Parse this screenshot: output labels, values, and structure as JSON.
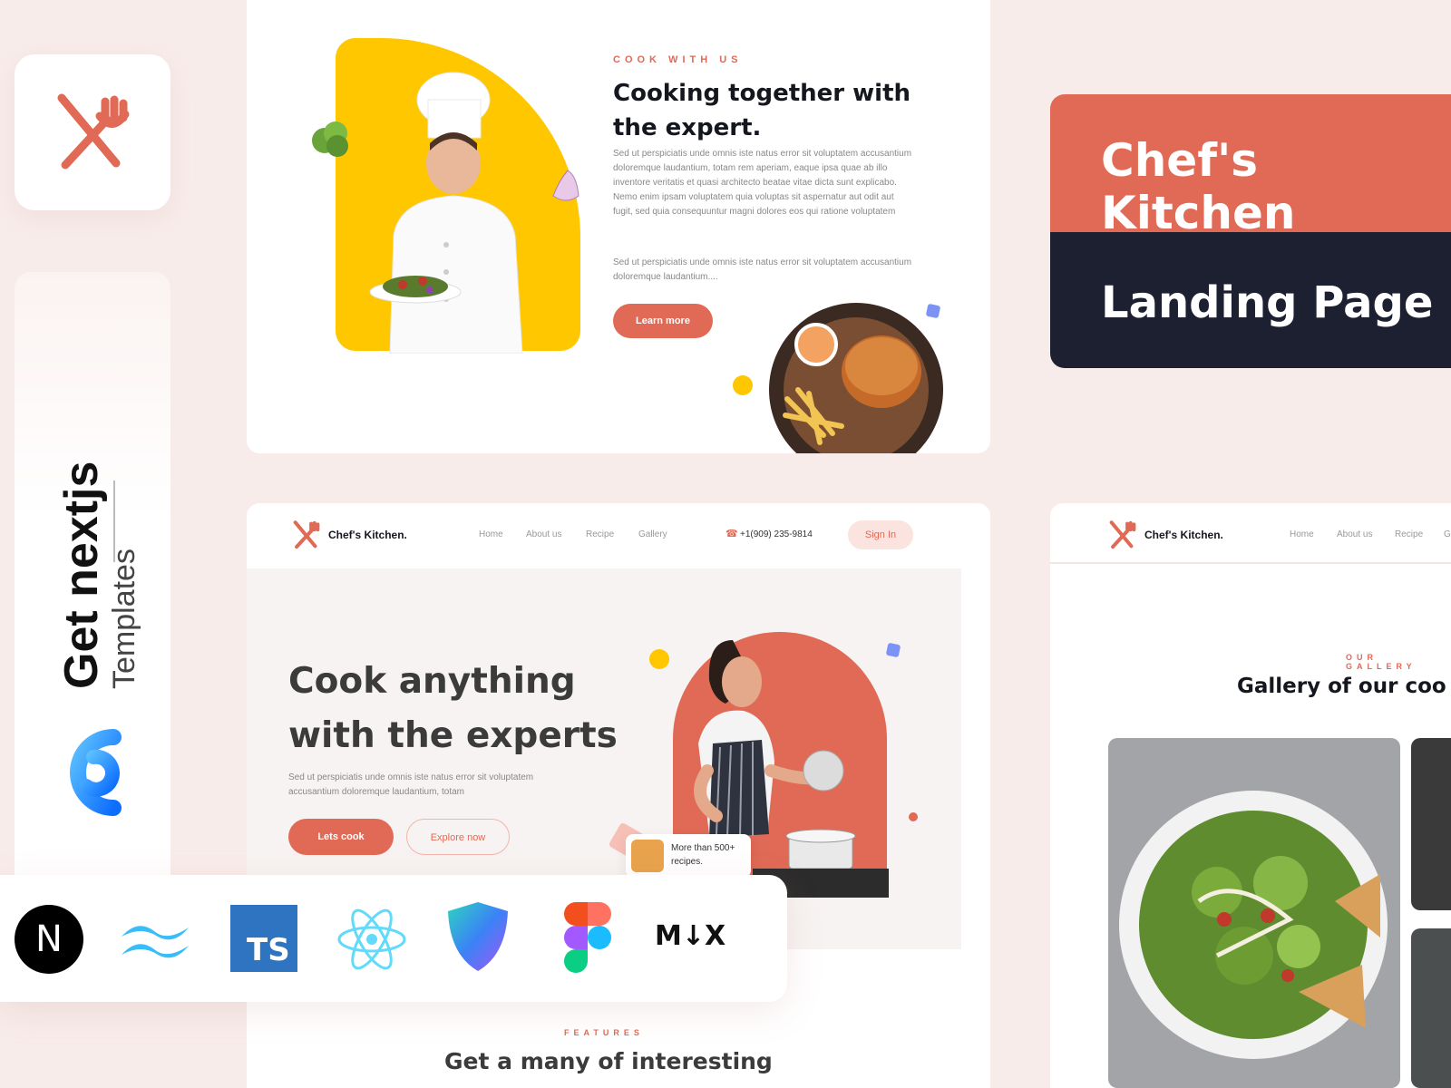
{
  "brand": {
    "main": "Get nextjs",
    "sub": "Templates"
  },
  "hero_card": {
    "eyebrow": "COOK WITH US",
    "heading_line1": "Cooking together with",
    "heading_line2": "the expert.",
    "paragraph1": "Sed ut perspiciatis unde omnis iste natus error sit voluptatem accusantium doloremque laudantium, totam rem aperiam, eaque ipsa quae ab illo inventore veritatis et quasi architecto beatae vitae dicta sunt explicabo. Nemo enim ipsam voluptatem quia voluptas sit aspernatur aut odit aut fugit, sed quia consequuntur magni dolores eos qui ratione voluptatem",
    "paragraph2": "Sed ut perspiciatis unde omnis iste natus error sit voluptatem accusantium doloremque laudantium....",
    "button": "Learn more"
  },
  "title_block": {
    "line1": "Chef's Kitchen",
    "line2": "Landing Page"
  },
  "landing_card": {
    "nav": {
      "logo": "Chef's Kitchen.",
      "links": [
        "Home",
        "About us",
        "Recipe",
        "Gallery"
      ],
      "phone": "+1(909) 235-9814",
      "signin": "Sign In"
    },
    "heading_line1": "Cook anything",
    "heading_line2": "with the experts",
    "paragraph": "Sed ut perspiciatis unde omnis iste natus error sit voluptatem accusantium doloremque laudantium, totam",
    "btn_primary": "Lets cook",
    "btn_secondary": "Explore now",
    "badge": "More than 500+ recipes.",
    "features_eyebrow": "FEATURES",
    "features_heading": "Get a many of interesting"
  },
  "gallery_card": {
    "nav": {
      "logo": "Chef's Kitchen.",
      "links": [
        "Home",
        "About us",
        "Recipe",
        "G"
      ]
    },
    "eyebrow": "OUR GALLERY",
    "heading": "Gallery of our coo"
  },
  "tech_stack": [
    "nextjs-icon",
    "tailwind-icon",
    "typescript-icon",
    "react-icon",
    "shield-icon",
    "figma-icon",
    "mdx-icon"
  ],
  "tech_labels": {
    "ts": "TS",
    "next": "N",
    "mdx": "M↓X"
  },
  "colors": {
    "accent": "#e06a55",
    "dark": "#1d2030",
    "yellow": "#ffc700",
    "background": "#f8ecea"
  }
}
